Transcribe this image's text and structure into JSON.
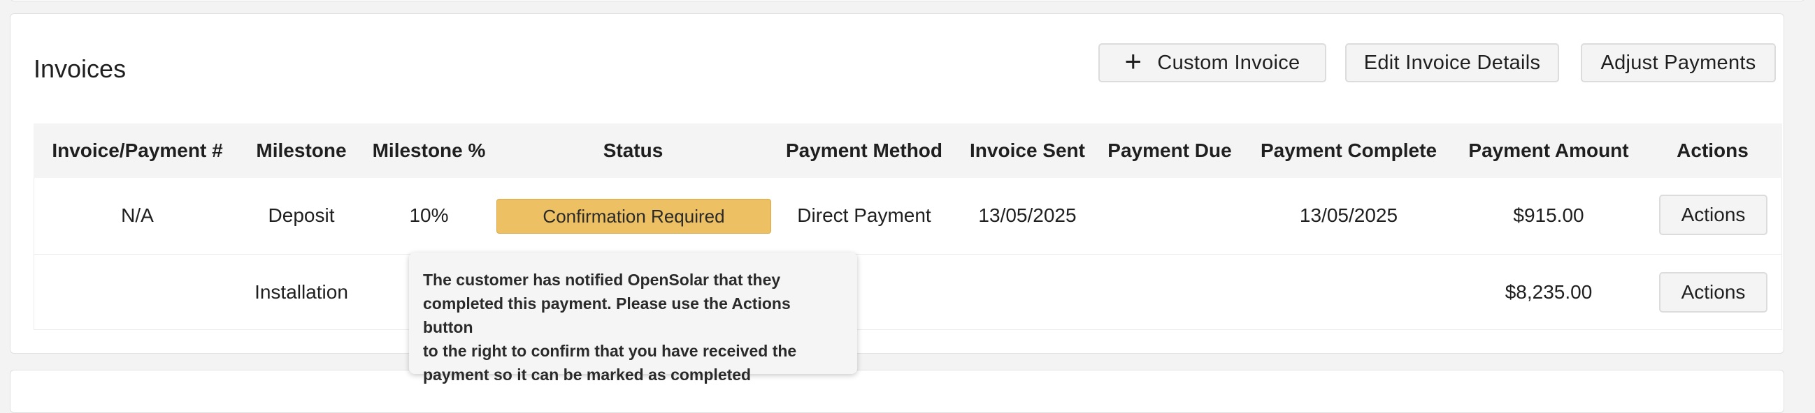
{
  "section": {
    "title": "Invoices",
    "buttons": {
      "custom_invoice": "Custom Invoice",
      "edit_invoice_details": "Edit Invoice Details",
      "adjust_payments": "Adjust Payments"
    }
  },
  "table": {
    "headers": [
      "Invoice/Payment #",
      "Milestone",
      "Milestone %",
      "Status",
      "Payment Method",
      "Invoice Sent",
      "Payment Due",
      "Payment Complete",
      "Payment Amount",
      "Actions"
    ],
    "rows": [
      {
        "invoice_number": "N/A",
        "milestone": "Deposit",
        "milestone_pct": "10%",
        "status": "Confirmation Required",
        "payment_method": "Direct Payment",
        "invoice_sent": "13/05/2025",
        "payment_due": "",
        "payment_complete": "13/05/2025",
        "amount": "$915.00",
        "action_label": "Actions"
      },
      {
        "invoice_number": "",
        "milestone": "Installation",
        "milestone_pct": "",
        "status": "",
        "payment_method": "",
        "invoice_sent": "",
        "payment_due": "",
        "payment_complete": "",
        "amount": "$8,235.00",
        "action_label": "Actions"
      }
    ]
  },
  "tooltip": {
    "lines": [
      "The customer has notified OpenSolar that they",
      "completed this payment. Please use the Actions button",
      "to the right to confirm that you have received the",
      "payment so it can be marked as completed"
    ]
  },
  "colors": {
    "status_confirmation_required": "#ecc063",
    "header_bg": "#f4f4f4"
  }
}
